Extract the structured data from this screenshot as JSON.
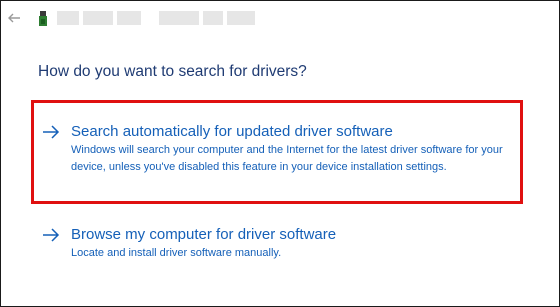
{
  "window": {
    "back_icon": "back-arrow-icon",
    "device_icon": "usb-device-icon"
  },
  "main": {
    "heading": "How do you want to search for drivers?",
    "options": [
      {
        "title": "Search automatically for updated driver software",
        "description": "Windows will search your computer and the Internet for the latest driver software for your device, unless you've disabled this feature in your device installation settings.",
        "icon": "right-arrow-icon",
        "highlighted": true
      },
      {
        "title": "Browse my computer for driver software",
        "description": "Locate and install driver software manually.",
        "icon": "right-arrow-icon",
        "highlighted": false
      }
    ]
  },
  "colors": {
    "heading": "#1f3b73",
    "link": "#1560b8",
    "highlight_border": "#e01010"
  }
}
